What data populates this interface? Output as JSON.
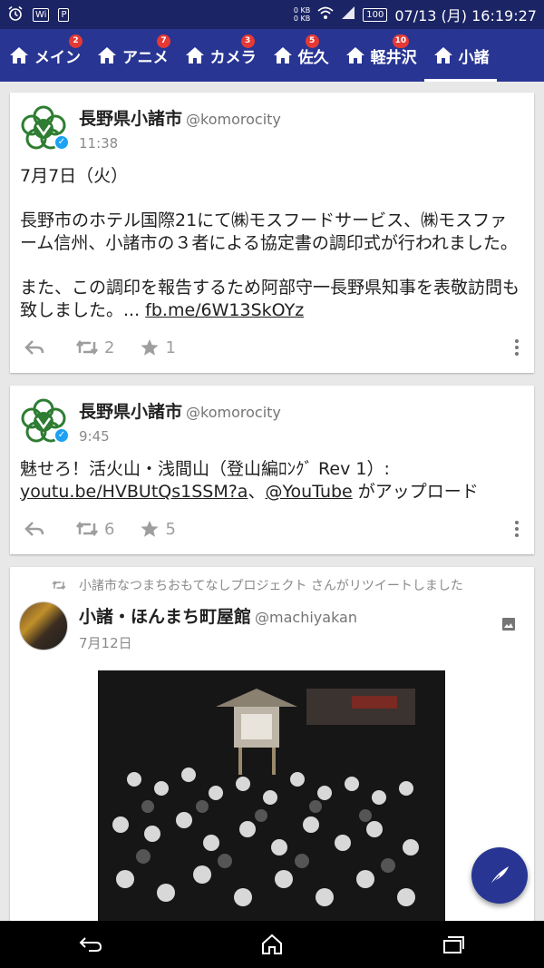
{
  "status_bar": {
    "network_up": "0 KB",
    "network_down": "0 KB",
    "battery": "100",
    "datetime": "07/13 (月) 16:19:27",
    "icons": [
      "alarm-icon",
      "wifi-icon",
      "parking-icon",
      "wifi-signal-icon",
      "cell-signal-icon",
      "battery-icon"
    ]
  },
  "tabs": [
    {
      "label": "メイン",
      "badge": "2",
      "active": false
    },
    {
      "label": "アニメ",
      "badge": "7",
      "active": false
    },
    {
      "label": "カメラ",
      "badge": "3",
      "active": false
    },
    {
      "label": "佐久",
      "badge": "5",
      "active": false
    },
    {
      "label": "軽井沢",
      "badge": "10",
      "active": false
    },
    {
      "label": "小諸",
      "badge": "",
      "active": true
    }
  ],
  "tweets": [
    {
      "name": "長野県小諸市",
      "handle": "@komorocity",
      "time": "11:38",
      "paragraphs": [
        "7月7日（火）",
        "長野市のホテル国際21にて㈱モスフードサービス、㈱モスファーム信州、小諸市の３者による協定書の調印式が行われました。",
        "また、この調印を報告するため阿部守一長野県知事を表敬訪問も致しました。..."
      ],
      "link": "fb.me/6W13SkOYz",
      "retweets": "2",
      "favorites": "1"
    },
    {
      "name": "長野県小諸市",
      "handle": "@komorocity",
      "time": "9:45",
      "text_a": "魅せろ！活火山・浅間山（登山編ﾛﾝｸﾞ Rev 1）: ",
      "link_a": "youtu.be/HVBUtQs1SSM?a",
      "text_b": "、",
      "link_b": "@YouTube",
      "text_c": " がアップロード",
      "retweets": "6",
      "favorites": "5"
    },
    {
      "retweeted_by": "小諸市なつまちおもてなしプロジェクト さんがリツイートしました",
      "name": "小諸・ほんまち町屋館",
      "handle": "@machiyakan",
      "time": "7月12日"
    }
  ]
}
